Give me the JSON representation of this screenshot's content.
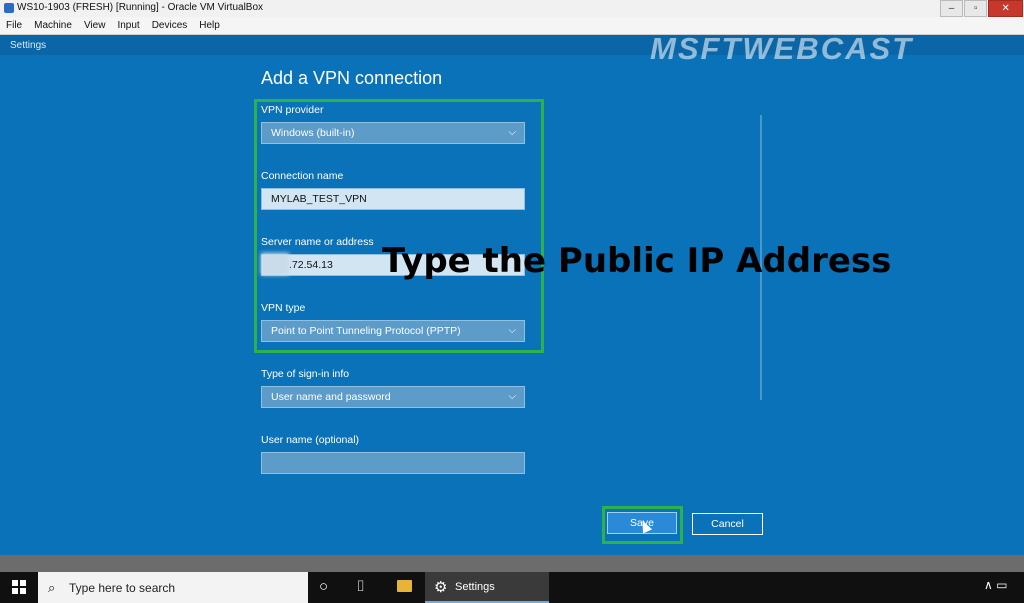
{
  "host_window": {
    "title": "WS10-1903 (FRESH) [Running] - Oracle VM VirtualBox",
    "menu": [
      "File",
      "Machine",
      "View",
      "Input",
      "Devices",
      "Help"
    ],
    "controls": [
      "–",
      "▫",
      "✕"
    ]
  },
  "watermark": "MSFTWEBCAST",
  "settings_bar_title": "Settings",
  "dialog": {
    "title": "Add a VPN connection",
    "vpn_provider": {
      "label": "VPN provider",
      "value": "Windows (built-in)"
    },
    "connection_name": {
      "label": "Connection name",
      "value": "MYLAB_TEST_VPN"
    },
    "server": {
      "label": "Server name or address",
      "value": ".72.54.13"
    },
    "vpn_type": {
      "label": "VPN type",
      "value": "Point to Point Tunneling Protocol (PPTP)"
    },
    "signin_type": {
      "label": "Type of sign-in info",
      "value": "User name and password"
    },
    "username": {
      "label": "User name (optional)",
      "value": ""
    },
    "save_label": "Save",
    "cancel_label": "Cancel"
  },
  "annotation": "Type the Public IP Address",
  "taskbar": {
    "search_placeholder": "Type here to search",
    "active_app": "Settings"
  },
  "colors": {
    "background": "#0a72b8",
    "highlight": "#2db14a"
  }
}
